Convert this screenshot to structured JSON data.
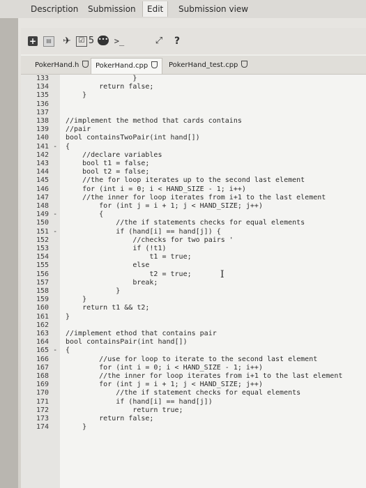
{
  "top_tabs": {
    "description": "Description",
    "submission": "Submission",
    "edit": "Edit",
    "submission_view": "Submission view"
  },
  "toolbar": {
    "add": "+",
    "save": "▤",
    "pin": "✈",
    "check": "☑",
    "count": "5",
    "comment": "•••",
    "terminal": ">_",
    "expand": "⤢",
    "help": "?"
  },
  "file_tabs": [
    "PokerHand.h",
    "PokerHand.cpp",
    "PokerHand_test.cpp"
  ],
  "code": [
    {
      "ln": "133",
      "text": "                }"
    },
    {
      "ln": "134",
      "text": "        return false;"
    },
    {
      "ln": "135",
      "text": "    }"
    },
    {
      "ln": "136",
      "text": ""
    },
    {
      "ln": "137",
      "text": ""
    },
    {
      "ln": "138",
      "text": "//implement the method that cards contains"
    },
    {
      "ln": "139",
      "text": "//pair"
    },
    {
      "ln": "140",
      "text": "bool containsTwoPair(int hand[])"
    },
    {
      "ln": "141 -",
      "text": "{"
    },
    {
      "ln": "142",
      "text": "    //declare variables"
    },
    {
      "ln": "143",
      "text": "    bool t1 = false;"
    },
    {
      "ln": "144",
      "text": "    bool t2 = false;"
    },
    {
      "ln": "145",
      "text": "    //the for loop iterates up to the second last element"
    },
    {
      "ln": "146",
      "text": "    for (int i = 0; i < HAND_SIZE - 1; i++)"
    },
    {
      "ln": "147",
      "text": "    //the inner for loop iterates from i+1 to the last element"
    },
    {
      "ln": "148",
      "text": "        for (int j = i + 1; j < HAND_SIZE; j++)"
    },
    {
      "ln": "149 -",
      "text": "        {"
    },
    {
      "ln": "150",
      "text": "            //the if statements checks for equal elements"
    },
    {
      "ln": "151 -",
      "text": "            if (hand[i] == hand[j]) {"
    },
    {
      "ln": "152",
      "text": "                //checks for two pairs '"
    },
    {
      "ln": "153",
      "text": "                if (!t1)"
    },
    {
      "ln": "154",
      "text": "                    t1 = true;"
    },
    {
      "ln": "155",
      "text": "                else"
    },
    {
      "ln": "156",
      "text": "                    t2 = true;"
    },
    {
      "ln": "157",
      "text": "                break;"
    },
    {
      "ln": "158",
      "text": "            }"
    },
    {
      "ln": "159",
      "text": "    }"
    },
    {
      "ln": "160",
      "text": "    return t1 && t2;"
    },
    {
      "ln": "161",
      "text": "}"
    },
    {
      "ln": "162",
      "text": ""
    },
    {
      "ln": "163",
      "text": "//implement ethod that contains pair"
    },
    {
      "ln": "164",
      "text": "bool containsPair(int hand[])"
    },
    {
      "ln": "165 -",
      "text": "{"
    },
    {
      "ln": "166",
      "text": "        //use for loop to iterate to the second last element"
    },
    {
      "ln": "167",
      "text": "        for (int i = 0; i < HAND_SIZE - 1; i++)"
    },
    {
      "ln": "168",
      "text": "        //the inner for loop iterates from i+1 to the last element"
    },
    {
      "ln": "169",
      "text": "        for (int j = i + 1; j < HAND_SIZE; j++)"
    },
    {
      "ln": "170",
      "text": "            //the if statement checks for equal elements"
    },
    {
      "ln": "171",
      "text": "            if (hand[i] == hand[j])"
    },
    {
      "ln": "172",
      "text": "                return true;"
    },
    {
      "ln": "173",
      "text": "        return false;"
    },
    {
      "ln": "174",
      "text": "    }"
    }
  ],
  "text_cursor": "I"
}
